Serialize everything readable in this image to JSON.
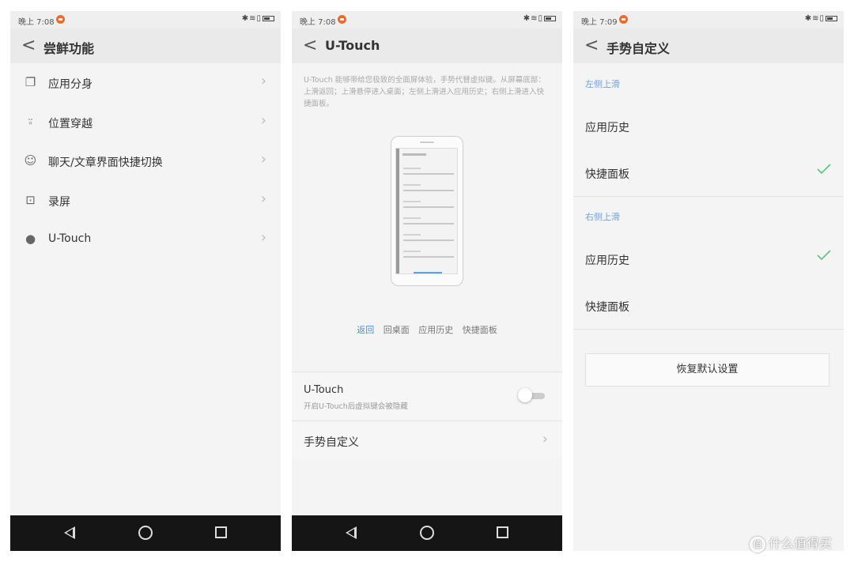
{
  "screen1": {
    "status_time": "晚上 7:08",
    "title": "尝鲜功能",
    "items": [
      {
        "label": "应用分身",
        "icon": "clone-icon"
      },
      {
        "label": "位置穿越",
        "icon": "location-icon"
      },
      {
        "label": "聊天/文章界面快捷切换",
        "icon": "smile-icon"
      },
      {
        "label": "录屏",
        "icon": "screen-record-icon"
      },
      {
        "label": "U-Touch",
        "icon": "dot-icon"
      }
    ]
  },
  "screen2": {
    "status_time": "晚上 7:08",
    "title": "U-Touch",
    "description": "U-Touch 能够带给您极致的全面屏体验，手势代替虚拟键。从屏幕底部：上滑返回；上滑悬停进入桌面；左侧上滑进入应用历史；右侧上滑进入快捷面板。",
    "gestures": [
      "返回",
      "回桌面",
      "应用历史",
      "快捷面板"
    ],
    "toggle_title": "U-Touch",
    "toggle_subtitle": "开启U-Touch后虚拟键会被隐藏",
    "toggle_on": false,
    "gesture_custom_label": "手势自定义"
  },
  "screen3": {
    "status_time": "晚上 7:09",
    "title": "手势自定义",
    "left_section": "左侧上滑",
    "left_options": [
      "应用历史",
      "快捷面板"
    ],
    "left_checked": 1,
    "right_section": "右侧上滑",
    "right_options": [
      "应用历史",
      "快捷面板"
    ],
    "right_checked": 0,
    "reset_label": "恢复默认设置"
  },
  "watermark": {
    "icon_text": "值",
    "text": "什么值得买"
  },
  "colors": {
    "accent": "#4a90e2",
    "check": "#5cc57a",
    "status_dot": "#f06a2a"
  }
}
